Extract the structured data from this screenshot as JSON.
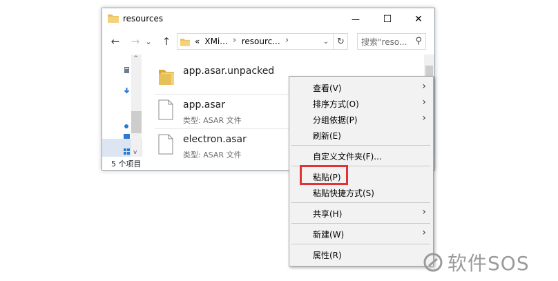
{
  "window": {
    "title": "resources",
    "minimize_glyph": "—",
    "maximize_glyph": "☐",
    "close_glyph": "✕"
  },
  "nav": {
    "back_glyph": "←",
    "forward_glyph": "→",
    "dropdown_glyph": "⌄",
    "up_glyph": "↑"
  },
  "address": {
    "prefix": "«",
    "segments": [
      "XMi...",
      "resourc..."
    ]
  },
  "search": {
    "placeholder": "搜索\"reso..."
  },
  "files": [
    {
      "name": "app.asar.unpacked",
      "type": "",
      "icon": "folder-icon"
    },
    {
      "name": "app.asar",
      "type": "类型: ASAR 文件",
      "icon": "file-icon"
    },
    {
      "name": "electron.asar",
      "type": "类型: ASAR 文件",
      "icon": "file-icon"
    }
  ],
  "status": {
    "item_count": "5 个项目"
  },
  "context_menu": {
    "items": [
      {
        "label": "查看(V)",
        "submenu": true
      },
      {
        "label": "排序方式(O)",
        "submenu": true
      },
      {
        "label": "分组依据(P)",
        "submenu": true
      },
      {
        "label": "刷新(E)",
        "submenu": false
      },
      {
        "label": "自定义文件夹(F)...",
        "submenu": false
      },
      {
        "label": "粘贴(P)",
        "submenu": false
      },
      {
        "label": "粘贴快捷方式(S)",
        "submenu": false
      },
      {
        "label": "共享(H)",
        "submenu": true
      },
      {
        "label": "新建(W)",
        "submenu": true
      },
      {
        "label": "属性(R)",
        "submenu": false
      }
    ]
  },
  "watermark": {
    "text": "软件SOS"
  },
  "colors": {
    "folder": "#e8c05a",
    "highlight": "#e33232",
    "menu_bg": "#f2f2f2"
  }
}
